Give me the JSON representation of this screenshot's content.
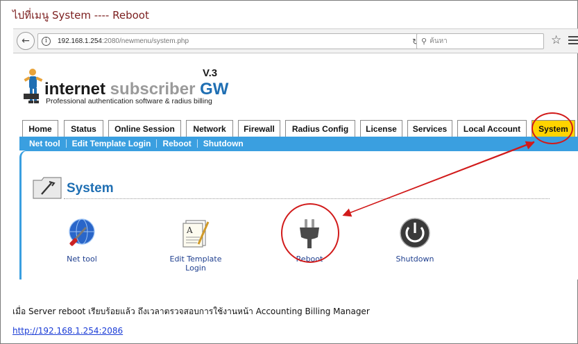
{
  "heading": "ไปที่เมนู  System  ---- Reboot",
  "browser": {
    "url_host": "192.168.1.254",
    "url_path": ":2080/newmenu/system.php",
    "search_placeholder": "ค้นหา"
  },
  "logo": {
    "word1": "internet",
    "word2": " subscriber",
    "word3": " GW",
    "version": "V.3",
    "tagline": "Professional authentication software & radius billing"
  },
  "tabs": [
    {
      "label": "Home"
    },
    {
      "label": "Status"
    },
    {
      "label": "Online Session"
    },
    {
      "label": "Network"
    },
    {
      "label": "Firewall"
    },
    {
      "label": "Radius Config"
    },
    {
      "label": "License"
    },
    {
      "label": "Services"
    },
    {
      "label": "Local Account"
    },
    {
      "label": "System",
      "active": true
    }
  ],
  "subnav": [
    "Net tool",
    "Edit Template Login",
    "Reboot",
    "Shutdown"
  ],
  "panel_title": "System",
  "tools": [
    {
      "label": "Net tool",
      "icon": "net-tool-icon"
    },
    {
      "label": "Edit Template Login",
      "icon": "edit-template-icon"
    },
    {
      "label": "Reboot",
      "icon": "power-plug-icon"
    },
    {
      "label": "Shutdown",
      "icon": "power-icon"
    }
  ],
  "note": "เมื่อ  Server reboot   เรียบร้อยแล้ว ถึงเวลาตรวจสอบการใช้งานหน้า  Accounting Billing Manager",
  "link": "http://192.168.1.254:2086",
  "colors": {
    "accent_blue": "#3a9fe0",
    "active_tab": "#ffd400",
    "callout_red": "#d11a1a",
    "heading": "#7b1e1e"
  }
}
